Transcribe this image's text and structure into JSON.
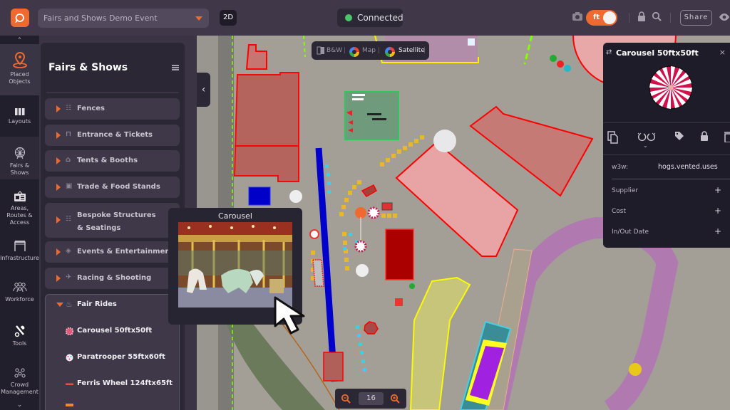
{
  "topbar": {
    "event_name": "Fairs and Shows Demo Event",
    "view_mode": "2D",
    "connection_status": "Connected",
    "connection_color": "#4cc46a",
    "unit_toggle": "ft",
    "share_label": "Share",
    "accent": "#ee6a2e"
  },
  "leftnav": {
    "items": [
      {
        "label": "Placed Objects",
        "icon": "map-pin-icon"
      },
      {
        "label": "Layouts",
        "icon": "layouts-icon"
      },
      {
        "label": "Fairs & Shows",
        "icon": "ferris-wheel-icon"
      },
      {
        "label": "Areas, Routes & Access",
        "icon": "map-board-icon"
      },
      {
        "label": "Infrastructure",
        "icon": "gazebo-icon"
      },
      {
        "label": "Workforce",
        "icon": "people-icon"
      },
      {
        "label": "Tools",
        "icon": "tools-icon"
      },
      {
        "label": "Crowd Management",
        "icon": "crowd-icon"
      }
    ]
  },
  "panel": {
    "title": "Fairs & Shows",
    "categories": [
      {
        "label": "Fences",
        "icon": "fence-icon"
      },
      {
        "label": "Entrance & Tickets",
        "icon": "entrance-icon"
      },
      {
        "label": "Tents & Booths",
        "icon": "tent-icon"
      },
      {
        "label": "Trade & Food Stands",
        "icon": "food-stand-icon"
      },
      {
        "label": "Bespoke Structures & Seatings",
        "icon": "seating-icon"
      },
      {
        "label": "Events & Entertainment",
        "icon": "entertainment-icon"
      },
      {
        "label": "Racing & Shooting",
        "icon": "racing-icon"
      }
    ],
    "expanded": {
      "label": "Fair Rides",
      "items": [
        {
          "label": "Carousel 50ftx50ft"
        },
        {
          "label": "Paratrooper 55ftx60ft"
        },
        {
          "label": "Ferris Wheel 124ftx65ft"
        }
      ]
    }
  },
  "map": {
    "layer_buttons": [
      "B&W",
      "Map",
      "Satellite"
    ],
    "zoom_level": "16"
  },
  "popup": {
    "title": "Carousel"
  },
  "details": {
    "title": "Carousel 50ftx50ft",
    "w3w_label": "w3w:",
    "w3w_value": "hogs.vented.uses",
    "rows": [
      "Supplier",
      "Cost",
      "In/Out Date"
    ]
  }
}
